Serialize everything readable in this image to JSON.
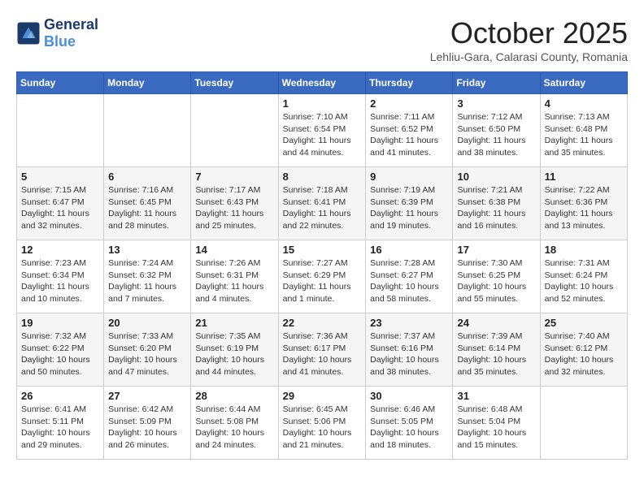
{
  "header": {
    "logo_line1": "General",
    "logo_line2": "Blue",
    "month_title": "October 2025",
    "subtitle": "Lehliu-Gara, Calarasi County, Romania"
  },
  "days_of_week": [
    "Sunday",
    "Monday",
    "Tuesday",
    "Wednesday",
    "Thursday",
    "Friday",
    "Saturday"
  ],
  "weeks": [
    [
      {
        "day": "",
        "info": ""
      },
      {
        "day": "",
        "info": ""
      },
      {
        "day": "",
        "info": ""
      },
      {
        "day": "1",
        "info": "Sunrise: 7:10 AM\nSunset: 6:54 PM\nDaylight: 11 hours and 44 minutes."
      },
      {
        "day": "2",
        "info": "Sunrise: 7:11 AM\nSunset: 6:52 PM\nDaylight: 11 hours and 41 minutes."
      },
      {
        "day": "3",
        "info": "Sunrise: 7:12 AM\nSunset: 6:50 PM\nDaylight: 11 hours and 38 minutes."
      },
      {
        "day": "4",
        "info": "Sunrise: 7:13 AM\nSunset: 6:48 PM\nDaylight: 11 hours and 35 minutes."
      }
    ],
    [
      {
        "day": "5",
        "info": "Sunrise: 7:15 AM\nSunset: 6:47 PM\nDaylight: 11 hours and 32 minutes."
      },
      {
        "day": "6",
        "info": "Sunrise: 7:16 AM\nSunset: 6:45 PM\nDaylight: 11 hours and 28 minutes."
      },
      {
        "day": "7",
        "info": "Sunrise: 7:17 AM\nSunset: 6:43 PM\nDaylight: 11 hours and 25 minutes."
      },
      {
        "day": "8",
        "info": "Sunrise: 7:18 AM\nSunset: 6:41 PM\nDaylight: 11 hours and 22 minutes."
      },
      {
        "day": "9",
        "info": "Sunrise: 7:19 AM\nSunset: 6:39 PM\nDaylight: 11 hours and 19 minutes."
      },
      {
        "day": "10",
        "info": "Sunrise: 7:21 AM\nSunset: 6:38 PM\nDaylight: 11 hours and 16 minutes."
      },
      {
        "day": "11",
        "info": "Sunrise: 7:22 AM\nSunset: 6:36 PM\nDaylight: 11 hours and 13 minutes."
      }
    ],
    [
      {
        "day": "12",
        "info": "Sunrise: 7:23 AM\nSunset: 6:34 PM\nDaylight: 11 hours and 10 minutes."
      },
      {
        "day": "13",
        "info": "Sunrise: 7:24 AM\nSunset: 6:32 PM\nDaylight: 11 hours and 7 minutes."
      },
      {
        "day": "14",
        "info": "Sunrise: 7:26 AM\nSunset: 6:31 PM\nDaylight: 11 hours and 4 minutes."
      },
      {
        "day": "15",
        "info": "Sunrise: 7:27 AM\nSunset: 6:29 PM\nDaylight: 11 hours and 1 minute."
      },
      {
        "day": "16",
        "info": "Sunrise: 7:28 AM\nSunset: 6:27 PM\nDaylight: 10 hours and 58 minutes."
      },
      {
        "day": "17",
        "info": "Sunrise: 7:30 AM\nSunset: 6:25 PM\nDaylight: 10 hours and 55 minutes."
      },
      {
        "day": "18",
        "info": "Sunrise: 7:31 AM\nSunset: 6:24 PM\nDaylight: 10 hours and 52 minutes."
      }
    ],
    [
      {
        "day": "19",
        "info": "Sunrise: 7:32 AM\nSunset: 6:22 PM\nDaylight: 10 hours and 50 minutes."
      },
      {
        "day": "20",
        "info": "Sunrise: 7:33 AM\nSunset: 6:20 PM\nDaylight: 10 hours and 47 minutes."
      },
      {
        "day": "21",
        "info": "Sunrise: 7:35 AM\nSunset: 6:19 PM\nDaylight: 10 hours and 44 minutes."
      },
      {
        "day": "22",
        "info": "Sunrise: 7:36 AM\nSunset: 6:17 PM\nDaylight: 10 hours and 41 minutes."
      },
      {
        "day": "23",
        "info": "Sunrise: 7:37 AM\nSunset: 6:16 PM\nDaylight: 10 hours and 38 minutes."
      },
      {
        "day": "24",
        "info": "Sunrise: 7:39 AM\nSunset: 6:14 PM\nDaylight: 10 hours and 35 minutes."
      },
      {
        "day": "25",
        "info": "Sunrise: 7:40 AM\nSunset: 6:12 PM\nDaylight: 10 hours and 32 minutes."
      }
    ],
    [
      {
        "day": "26",
        "info": "Sunrise: 6:41 AM\nSunset: 5:11 PM\nDaylight: 10 hours and 29 minutes."
      },
      {
        "day": "27",
        "info": "Sunrise: 6:42 AM\nSunset: 5:09 PM\nDaylight: 10 hours and 26 minutes."
      },
      {
        "day": "28",
        "info": "Sunrise: 6:44 AM\nSunset: 5:08 PM\nDaylight: 10 hours and 24 minutes."
      },
      {
        "day": "29",
        "info": "Sunrise: 6:45 AM\nSunset: 5:06 PM\nDaylight: 10 hours and 21 minutes."
      },
      {
        "day": "30",
        "info": "Sunrise: 6:46 AM\nSunset: 5:05 PM\nDaylight: 10 hours and 18 minutes."
      },
      {
        "day": "31",
        "info": "Sunrise: 6:48 AM\nSunset: 5:04 PM\nDaylight: 10 hours and 15 minutes."
      },
      {
        "day": "",
        "info": ""
      }
    ]
  ]
}
